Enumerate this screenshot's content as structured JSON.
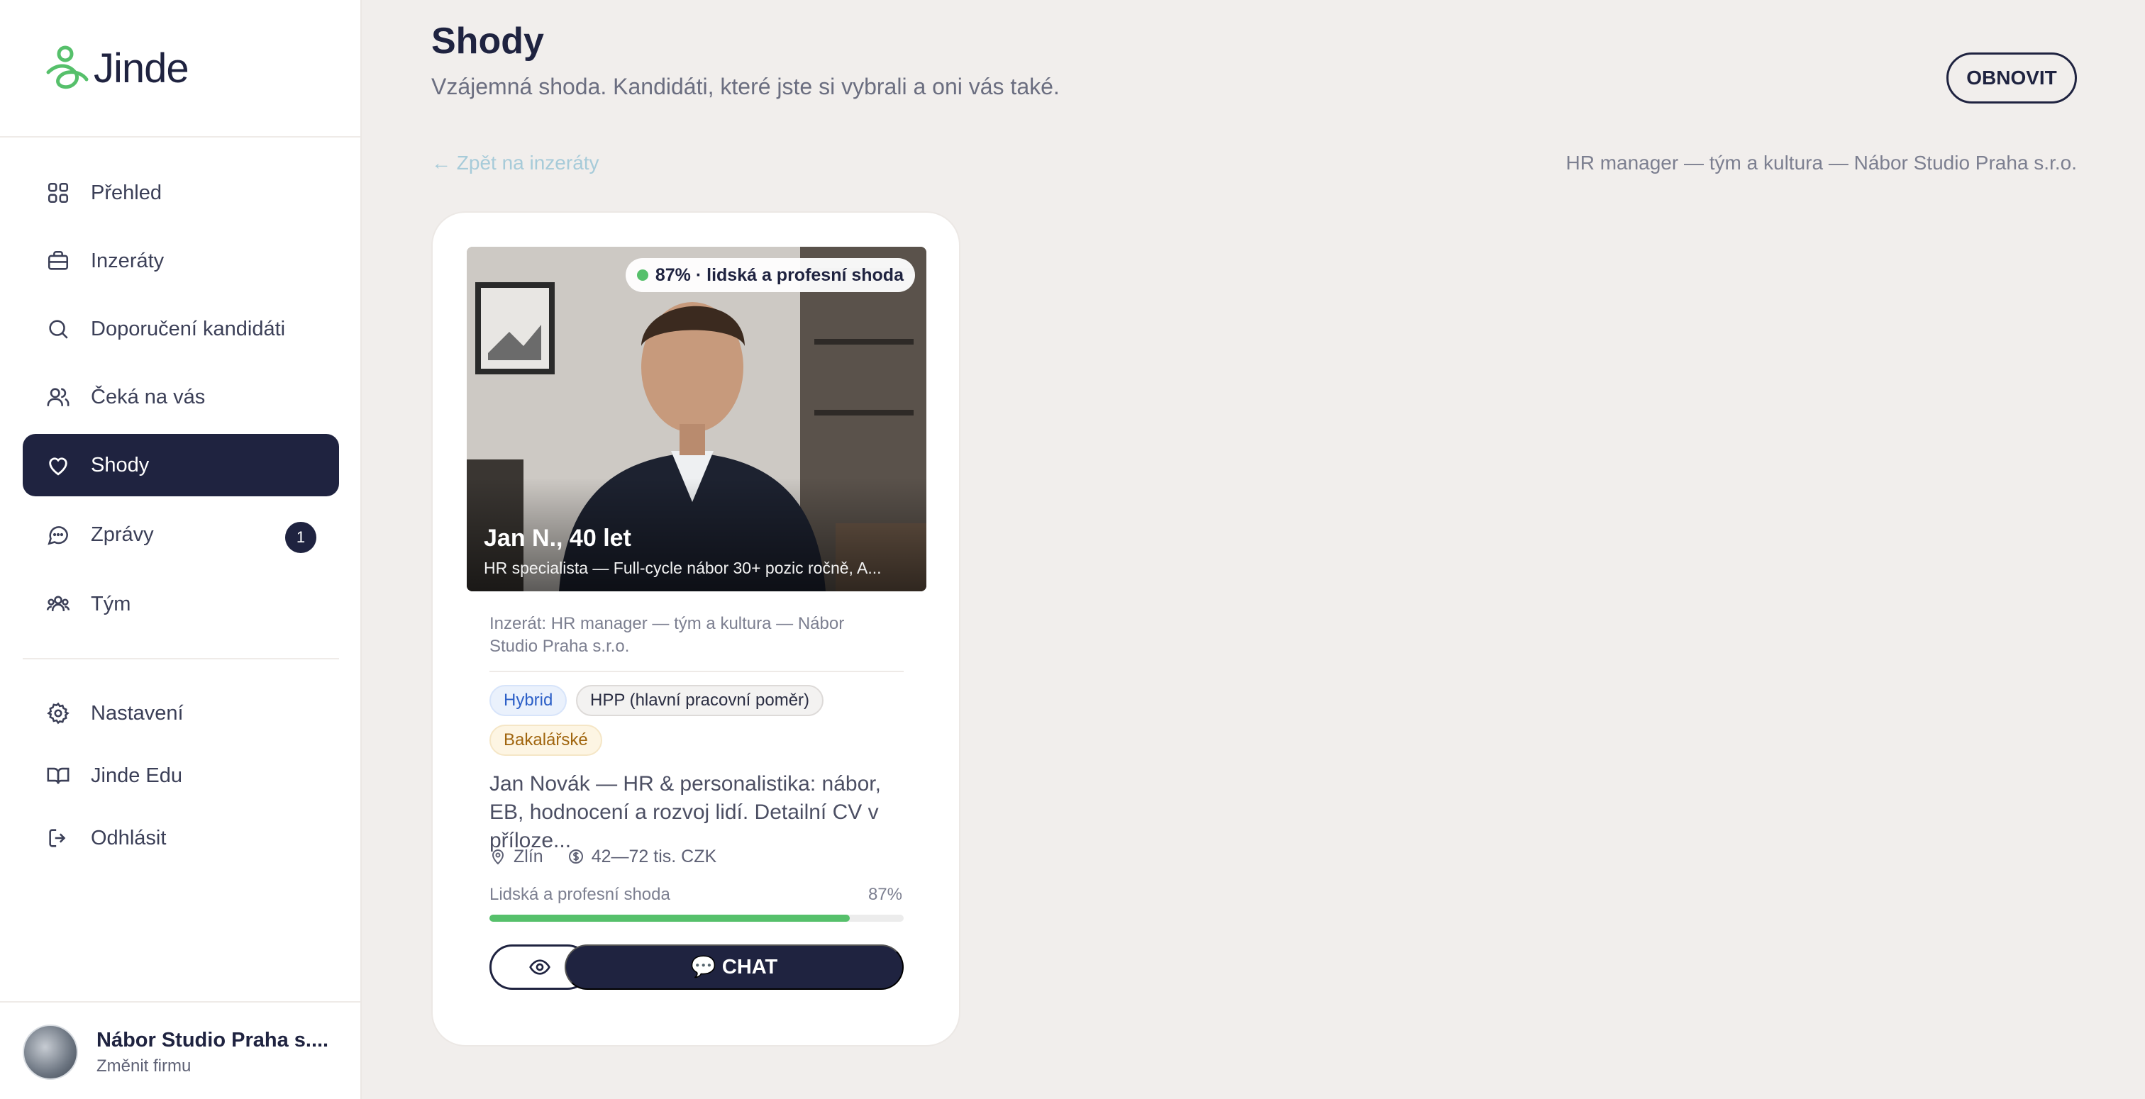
{
  "app": {
    "logo_text": "Jinde"
  },
  "sidebar": {
    "items": [
      {
        "label": "Přehled",
        "icon": "grid-icon"
      },
      {
        "label": "Inzeráty",
        "icon": "briefcase-icon"
      },
      {
        "label": "Doporučení kandidáti",
        "icon": "search-icon"
      },
      {
        "label": "Čeká na vás",
        "icon": "users-icon"
      },
      {
        "label": "Shody",
        "icon": "heart-icon",
        "active": true
      },
      {
        "label": "Zprávy",
        "icon": "chat-bubble-icon",
        "badge": "1"
      },
      {
        "label": "Tým",
        "icon": "team-icon"
      }
    ],
    "secondary": [
      {
        "label": "Nastavení",
        "icon": "gear-icon"
      },
      {
        "label": "Jinde Edu",
        "icon": "book-icon"
      },
      {
        "label": "Odhlásit",
        "icon": "logout-icon"
      }
    ],
    "company": {
      "name": "Nábor Studio Praha s....",
      "switch_label": "Změnit firmu"
    }
  },
  "header": {
    "title": "Shody",
    "subtitle": "Vzájemná shoda. Kandidáti, které jste si vybrali a oni vás také.",
    "refresh_label": "OBNOVIT",
    "back_label": "← Zpět na inzeráty",
    "job_context": "HR manager — tým a kultura — Nábor Studio Praha s.r.o."
  },
  "candidate": {
    "match_badge": "87% · lidská a profesní shoda",
    "name": "Jan N., 40 let",
    "headline": "HR specialista — Full-cycle nábor 30+ pozic ročně, A...",
    "job_line": "Inzerát: HR manager — tým a kultura — Nábor Studio Praha s.r.o.",
    "tags": [
      {
        "label": "Hybrid",
        "style": "blue"
      },
      {
        "label": "HPP (hlavní pracovní poměr)",
        "style": "gray"
      },
      {
        "label": "Bakalářské",
        "style": "yellow"
      }
    ],
    "description": "Jan Novák — HR & personalistika: nábor, EB, hodnocení a rozvoj lidí. Detailní CV v příloze...",
    "location": "Zlín",
    "salary": "42—72 tis. CZK",
    "score_label": "Lidská a profesní shoda",
    "score_text": "87%",
    "score_fraction": 0.87,
    "chat_label": "💬 CHAT"
  },
  "colors": {
    "navy": "#1f2340",
    "green": "#56c06b",
    "background": "#f1eeec"
  }
}
